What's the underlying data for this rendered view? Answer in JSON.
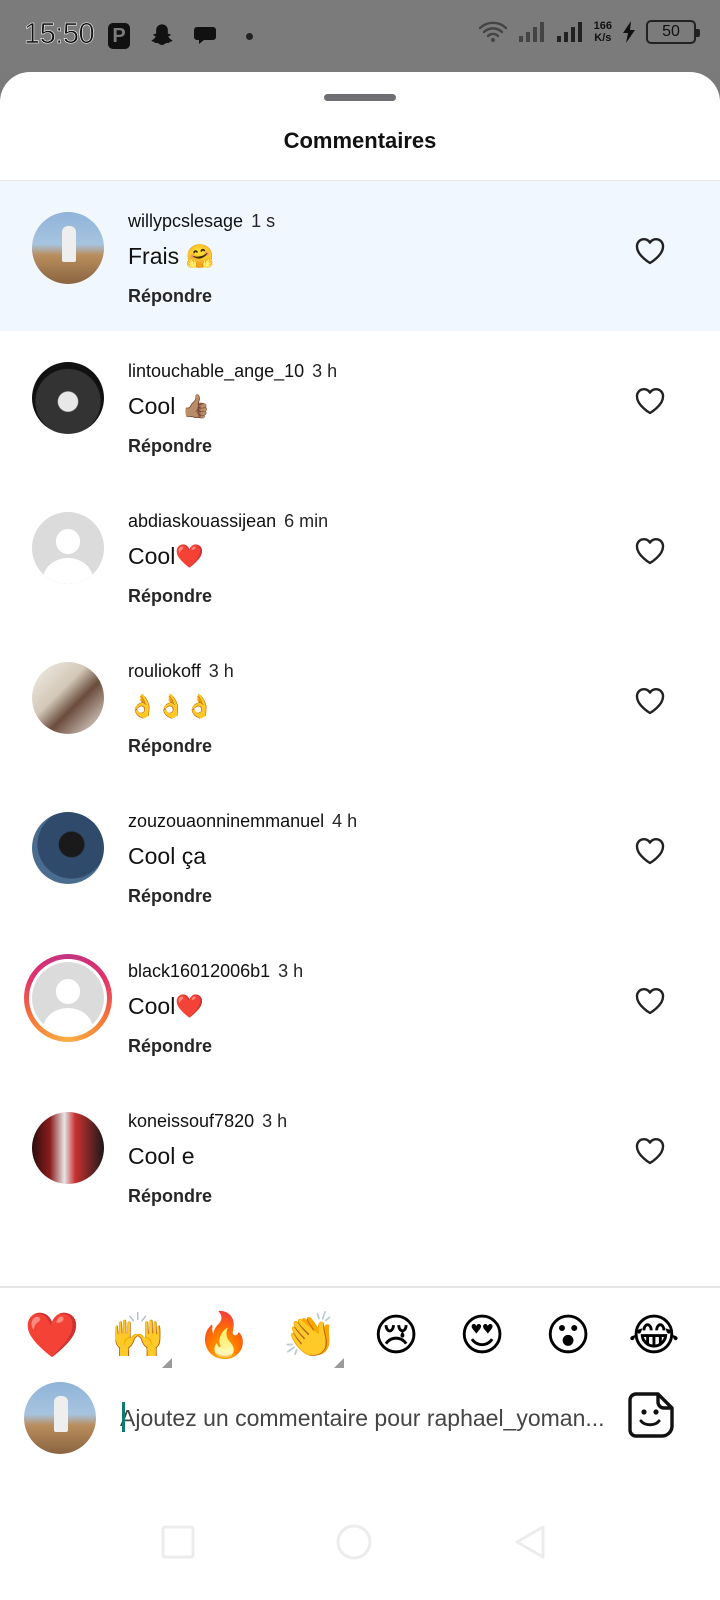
{
  "status_bar": {
    "time": "15:50",
    "net_speed_value": "166",
    "net_speed_unit": "K/s",
    "battery": "50"
  },
  "sheet": {
    "title": "Commentaires"
  },
  "comments": [
    {
      "username": "willypcslesage",
      "time": "1 s",
      "text": "Frais 🤗",
      "reply": "Répondre",
      "highlighted": true
    },
    {
      "username": "lintouchable_ange_10",
      "time": "3 h",
      "text": "Cool 👍🏽",
      "reply": "Répondre"
    },
    {
      "username": "abdiaskouassijean",
      "time": "6 min",
      "text": "Cool❤️",
      "reply": "Répondre"
    },
    {
      "username": "rouliokoff",
      "time": "3 h",
      "text": "👌👌👌",
      "reply": "Répondre"
    },
    {
      "username": "zouzouaonninemmanuel",
      "time": "4 h",
      "text": "Cool ça",
      "reply": "Répondre"
    },
    {
      "username": "black16012006b1",
      "time": "3 h",
      "text": "Cool❤️",
      "reply": "Répondre",
      "story_ring": true
    },
    {
      "username": "koneissouf7820",
      "time": "3 h",
      "text": "Cool e",
      "reply": "Répondre"
    }
  ],
  "quick_reactions": [
    "❤️",
    "🙌",
    "🔥",
    "👏",
    "😢",
    "😍",
    "😮",
    "😂"
  ],
  "composer": {
    "placeholder": "Ajoutez un commentaire pour raphael_yoman..."
  },
  "colors": {
    "highlight_bg": "#f1f7ff",
    "story_ring": "#e1306c",
    "caret": "#0f7a6e"
  }
}
